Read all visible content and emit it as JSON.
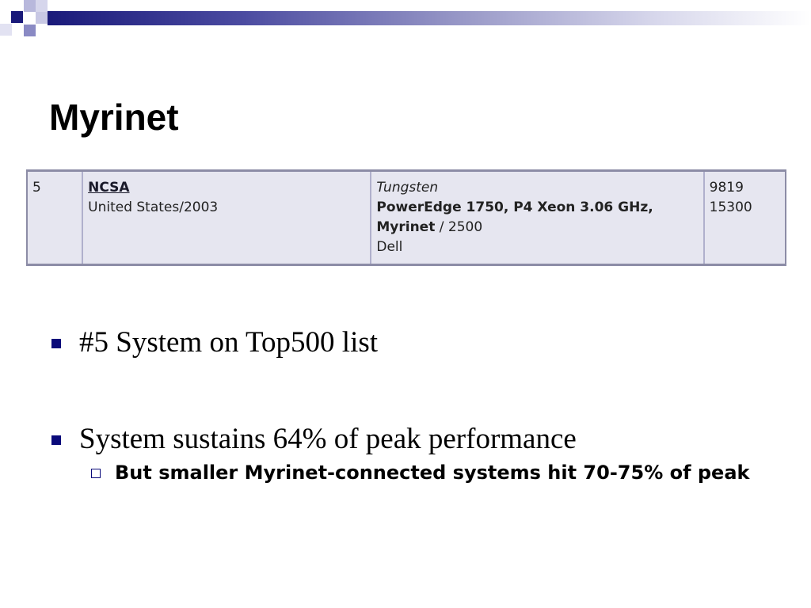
{
  "slide": {
    "title": "Myrinet"
  },
  "table": {
    "rank": "5",
    "site_name": "NCSA",
    "site_location": "United States/2003",
    "system_name": "Tungsten",
    "system_desc_bold": "PowerEdge 1750, P4 Xeon 3.06 GHz, Myrinet",
    "system_desc_suffix": " / 2500",
    "vendor": "Dell",
    "rmax": "9819",
    "rpeak": "15300"
  },
  "bullets": [
    {
      "text": "#5 System on Top500 list"
    },
    {
      "text": "System sustains 64% of peak performance",
      "sub": "But smaller Myrinet-connected systems hit 70-75% of peak"
    }
  ],
  "colors": {
    "accent": "#1a1a7a",
    "bullet_marker": "#0a0a7a",
    "table_bg": "#e6e6f0"
  }
}
